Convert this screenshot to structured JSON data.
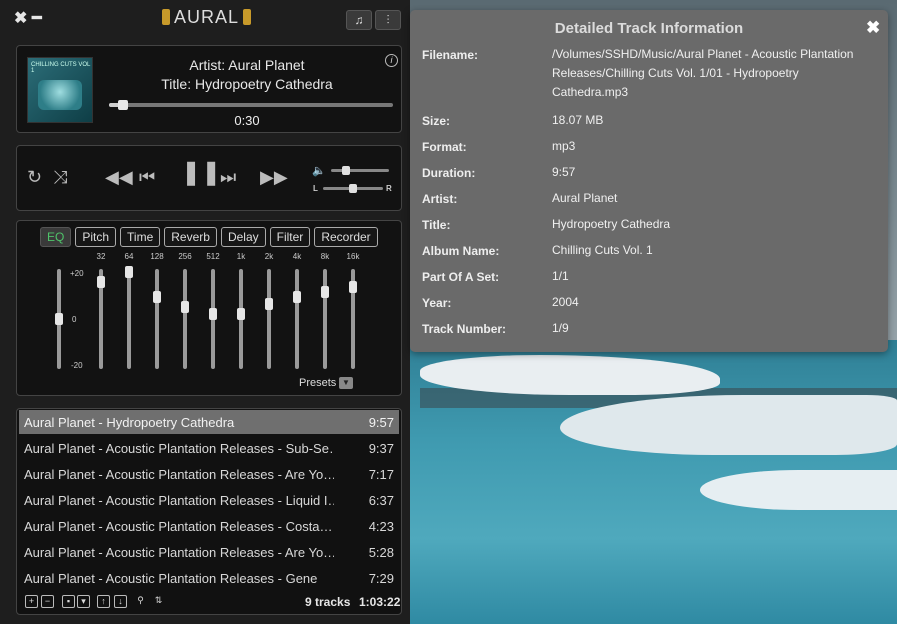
{
  "app": {
    "title": "AURAL"
  },
  "titlebar": {
    "close_icon": "close-icon",
    "minimize_icon": "minimize-icon",
    "playlist_toggle_icon": "playlist-icon",
    "effects_toggle_icon": "sliders-icon"
  },
  "now_playing": {
    "artist_line": "Artist: Aural Planet",
    "title_line": "Title:  Hydropoetry Cathedra",
    "elapsed": "0:30",
    "progress": 0.05,
    "info_icon": "info-icon",
    "cover_text": "CHILLING CUTS VOL 1"
  },
  "transport": {
    "repeat_icon": "repeat-icon",
    "shuffle_icon": "shuffle-icon",
    "seek_back_icon": "rewind-icon",
    "previous_icon": "skip-previous-icon",
    "play_pause_icon": "pause-icon",
    "next_icon": "skip-next-icon",
    "seek_forward_icon": "fast-forward-icon",
    "volume_icon": "volume-icon",
    "volume": 0.25,
    "balance": 0.5,
    "balance_left": "L",
    "balance_right": "R"
  },
  "effects": {
    "tabs": [
      "EQ",
      "Pitch",
      "Time",
      "Reverb",
      "Delay",
      "Filter",
      "Recorder"
    ],
    "active_tab": "EQ",
    "eq": {
      "scale": [
        "+20",
        "0",
        "-20"
      ],
      "preamp_db": 0,
      "bands": [
        {
          "freq": "32",
          "gain_db": 15
        },
        {
          "freq": "64",
          "gain_db": 19
        },
        {
          "freq": "128",
          "gain_db": 9
        },
        {
          "freq": "256",
          "gain_db": 5
        },
        {
          "freq": "512",
          "gain_db": 2
        },
        {
          "freq": "1k",
          "gain_db": 2
        },
        {
          "freq": "2k",
          "gain_db": 6
        },
        {
          "freq": "4k",
          "gain_db": 9
        },
        {
          "freq": "8k",
          "gain_db": 11
        },
        {
          "freq": "16k",
          "gain_db": 13
        }
      ],
      "presets_label": "Presets"
    }
  },
  "playlist": {
    "items": [
      {
        "title": "Aural Planet - Hydropoetry Cathedra",
        "duration": "9:57",
        "selected": true
      },
      {
        "title": "Aural Planet - Acoustic Plantation Releases - Sub-Se…",
        "duration": "9:37"
      },
      {
        "title": "Aural Planet - Acoustic Plantation Releases - Are Yo…",
        "duration": "7:17"
      },
      {
        "title": "Aural Planet - Acoustic Plantation Releases - Liquid I…",
        "duration": "6:37"
      },
      {
        "title": "Aural Planet - Acoustic Plantation Releases - Costa…",
        "duration": "4:23"
      },
      {
        "title": "Aural Planet - Acoustic Plantation Releases - Are Yo…",
        "duration": "5:28"
      },
      {
        "title": "Aural Planet - Acoustic Plantation Releases - Gene",
        "duration": "7:29"
      }
    ],
    "track_count": "9 tracks",
    "total_duration": "1:03:22"
  },
  "info_popover": {
    "title": "Detailed Track Information",
    "fields": [
      {
        "key": "Filename:",
        "value": "/Volumes/SSHD/Music/Aural Planet - Acoustic Plantation Releases/Chilling Cuts Vol. 1/01 - Hydropoetry Cathedra.mp3"
      },
      {
        "key": "Size:",
        "value": "18.07 MB"
      },
      {
        "key": "Format:",
        "value": "mp3"
      },
      {
        "key": "Duration:",
        "value": "9:57"
      },
      {
        "key": "Artist:",
        "value": "Aural Planet"
      },
      {
        "key": "Title:",
        "value": "Hydropoetry Cathedra"
      },
      {
        "key": "Album Name:",
        "value": "Chilling Cuts Vol. 1"
      },
      {
        "key": "Part Of A Set:",
        "value": "1/1"
      },
      {
        "key": "Year:",
        "value": "2004"
      },
      {
        "key": "Track Number:",
        "value": "1/9"
      }
    ]
  }
}
